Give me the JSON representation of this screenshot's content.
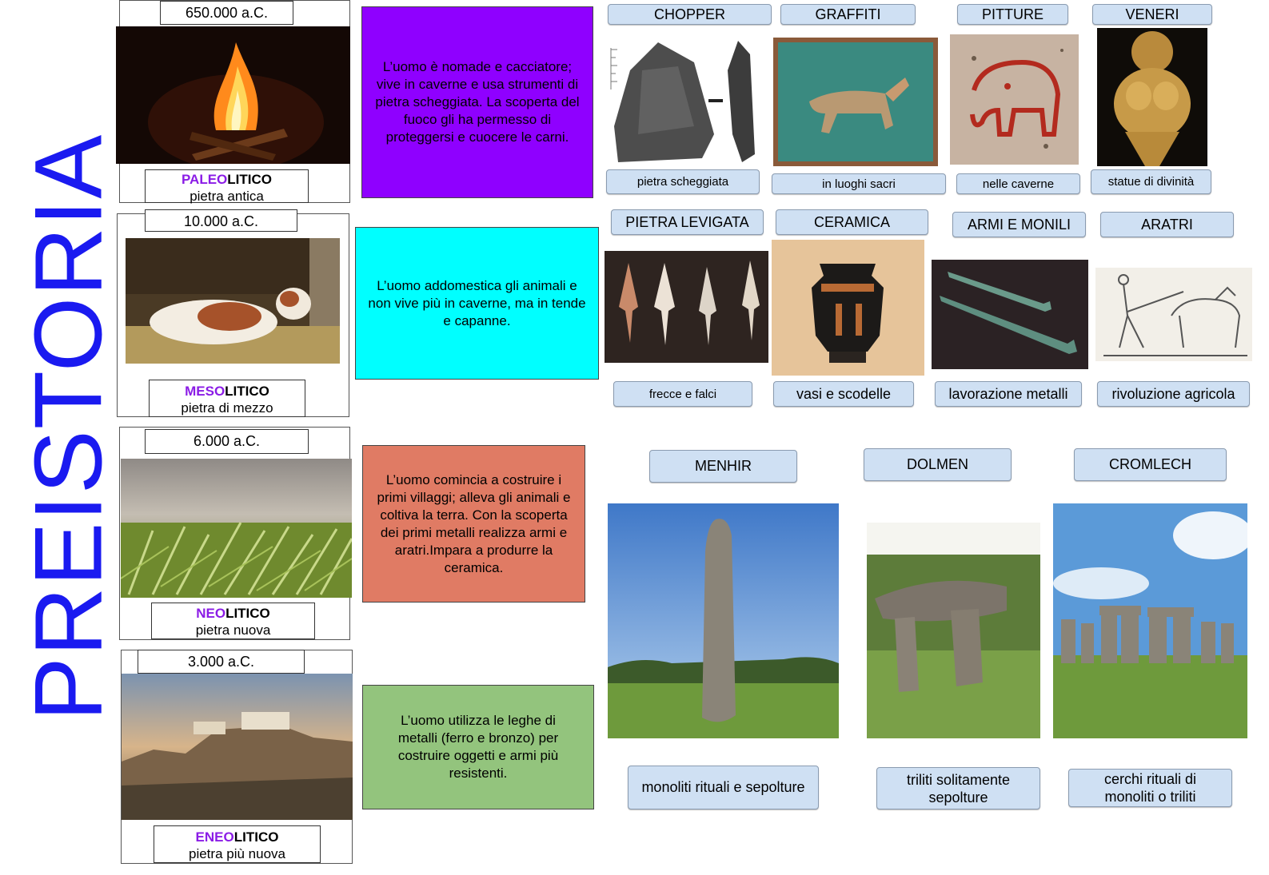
{
  "title": "PREISTORIA",
  "periods": [
    {
      "date": "650.000 a.C.",
      "prefix": "PALEO",
      "suffix": "LITICO",
      "subtitle": "pietra antica",
      "description": "L’uomo è nomade e cacciatore; vive in caverne e usa strumenti di pietra scheggiata. La scoperta del fuoco gli ha permesso di proteggersi e cuocere le carni."
    },
    {
      "date": "10.000 a.C.",
      "prefix": "MESO",
      "suffix": "LITICO",
      "subtitle": "pietra di mezzo",
      "description": "L’uomo addomestica gli animali e non vive più in caverne, ma in tende e capanne."
    },
    {
      "date": "6.000 a.C.",
      "prefix": "NEO",
      "suffix": "LITICO",
      "subtitle": "pietra nuova",
      "description": "L’uomo comincia a costruire i primi villaggi; alleva gli animali e coltiva la terra. Con la scoperta dei primi metalli realizza armi e aratri.Impara a produrre la ceramica."
    },
    {
      "date": "3.000 a.C.",
      "prefix": "ENEO",
      "suffix": "LITICO",
      "subtitle": "pietra più nuova",
      "description": "L’uomo utilizza le leghe di metalli (ferro e bronzo) per costruire oggetti e armi più resistenti."
    }
  ],
  "row1": [
    {
      "label": "CHOPPER",
      "caption": "pietra scheggiata"
    },
    {
      "label": "GRAFFITI",
      "caption": "in luoghi sacri"
    },
    {
      "label": "PITTURE",
      "caption": "nelle caverne"
    },
    {
      "label": "VENERI",
      "caption": "statue di divinità"
    }
  ],
  "row2": [
    {
      "label": "PIETRA LEVIGATA",
      "caption": "frecce e falci"
    },
    {
      "label": "CERAMICA",
      "caption": "vasi e scodelle"
    },
    {
      "label": "ARMI E MONILI",
      "caption": "lavorazione metalli"
    },
    {
      "label": "ARATRI",
      "caption": "rivoluzione agricola"
    }
  ],
  "monuments": [
    {
      "label": "MENHIR",
      "caption": "monoliti rituali e sepolture"
    },
    {
      "label": "DOLMEN",
      "caption": "triliti solitamente sepolture"
    },
    {
      "label": "CROMLECH",
      "caption": "cerchi rituali di monoliti o triliti"
    }
  ],
  "colors": {
    "title": "#1a1af0",
    "prefix": "#8b1ce6",
    "paleolitico_box": "#8f00ff",
    "mesolitico_box": "#00ffff",
    "neolitico_box": "#e07b64",
    "eneolitico_box": "#93c47d",
    "pill": "#cfe0f3"
  }
}
